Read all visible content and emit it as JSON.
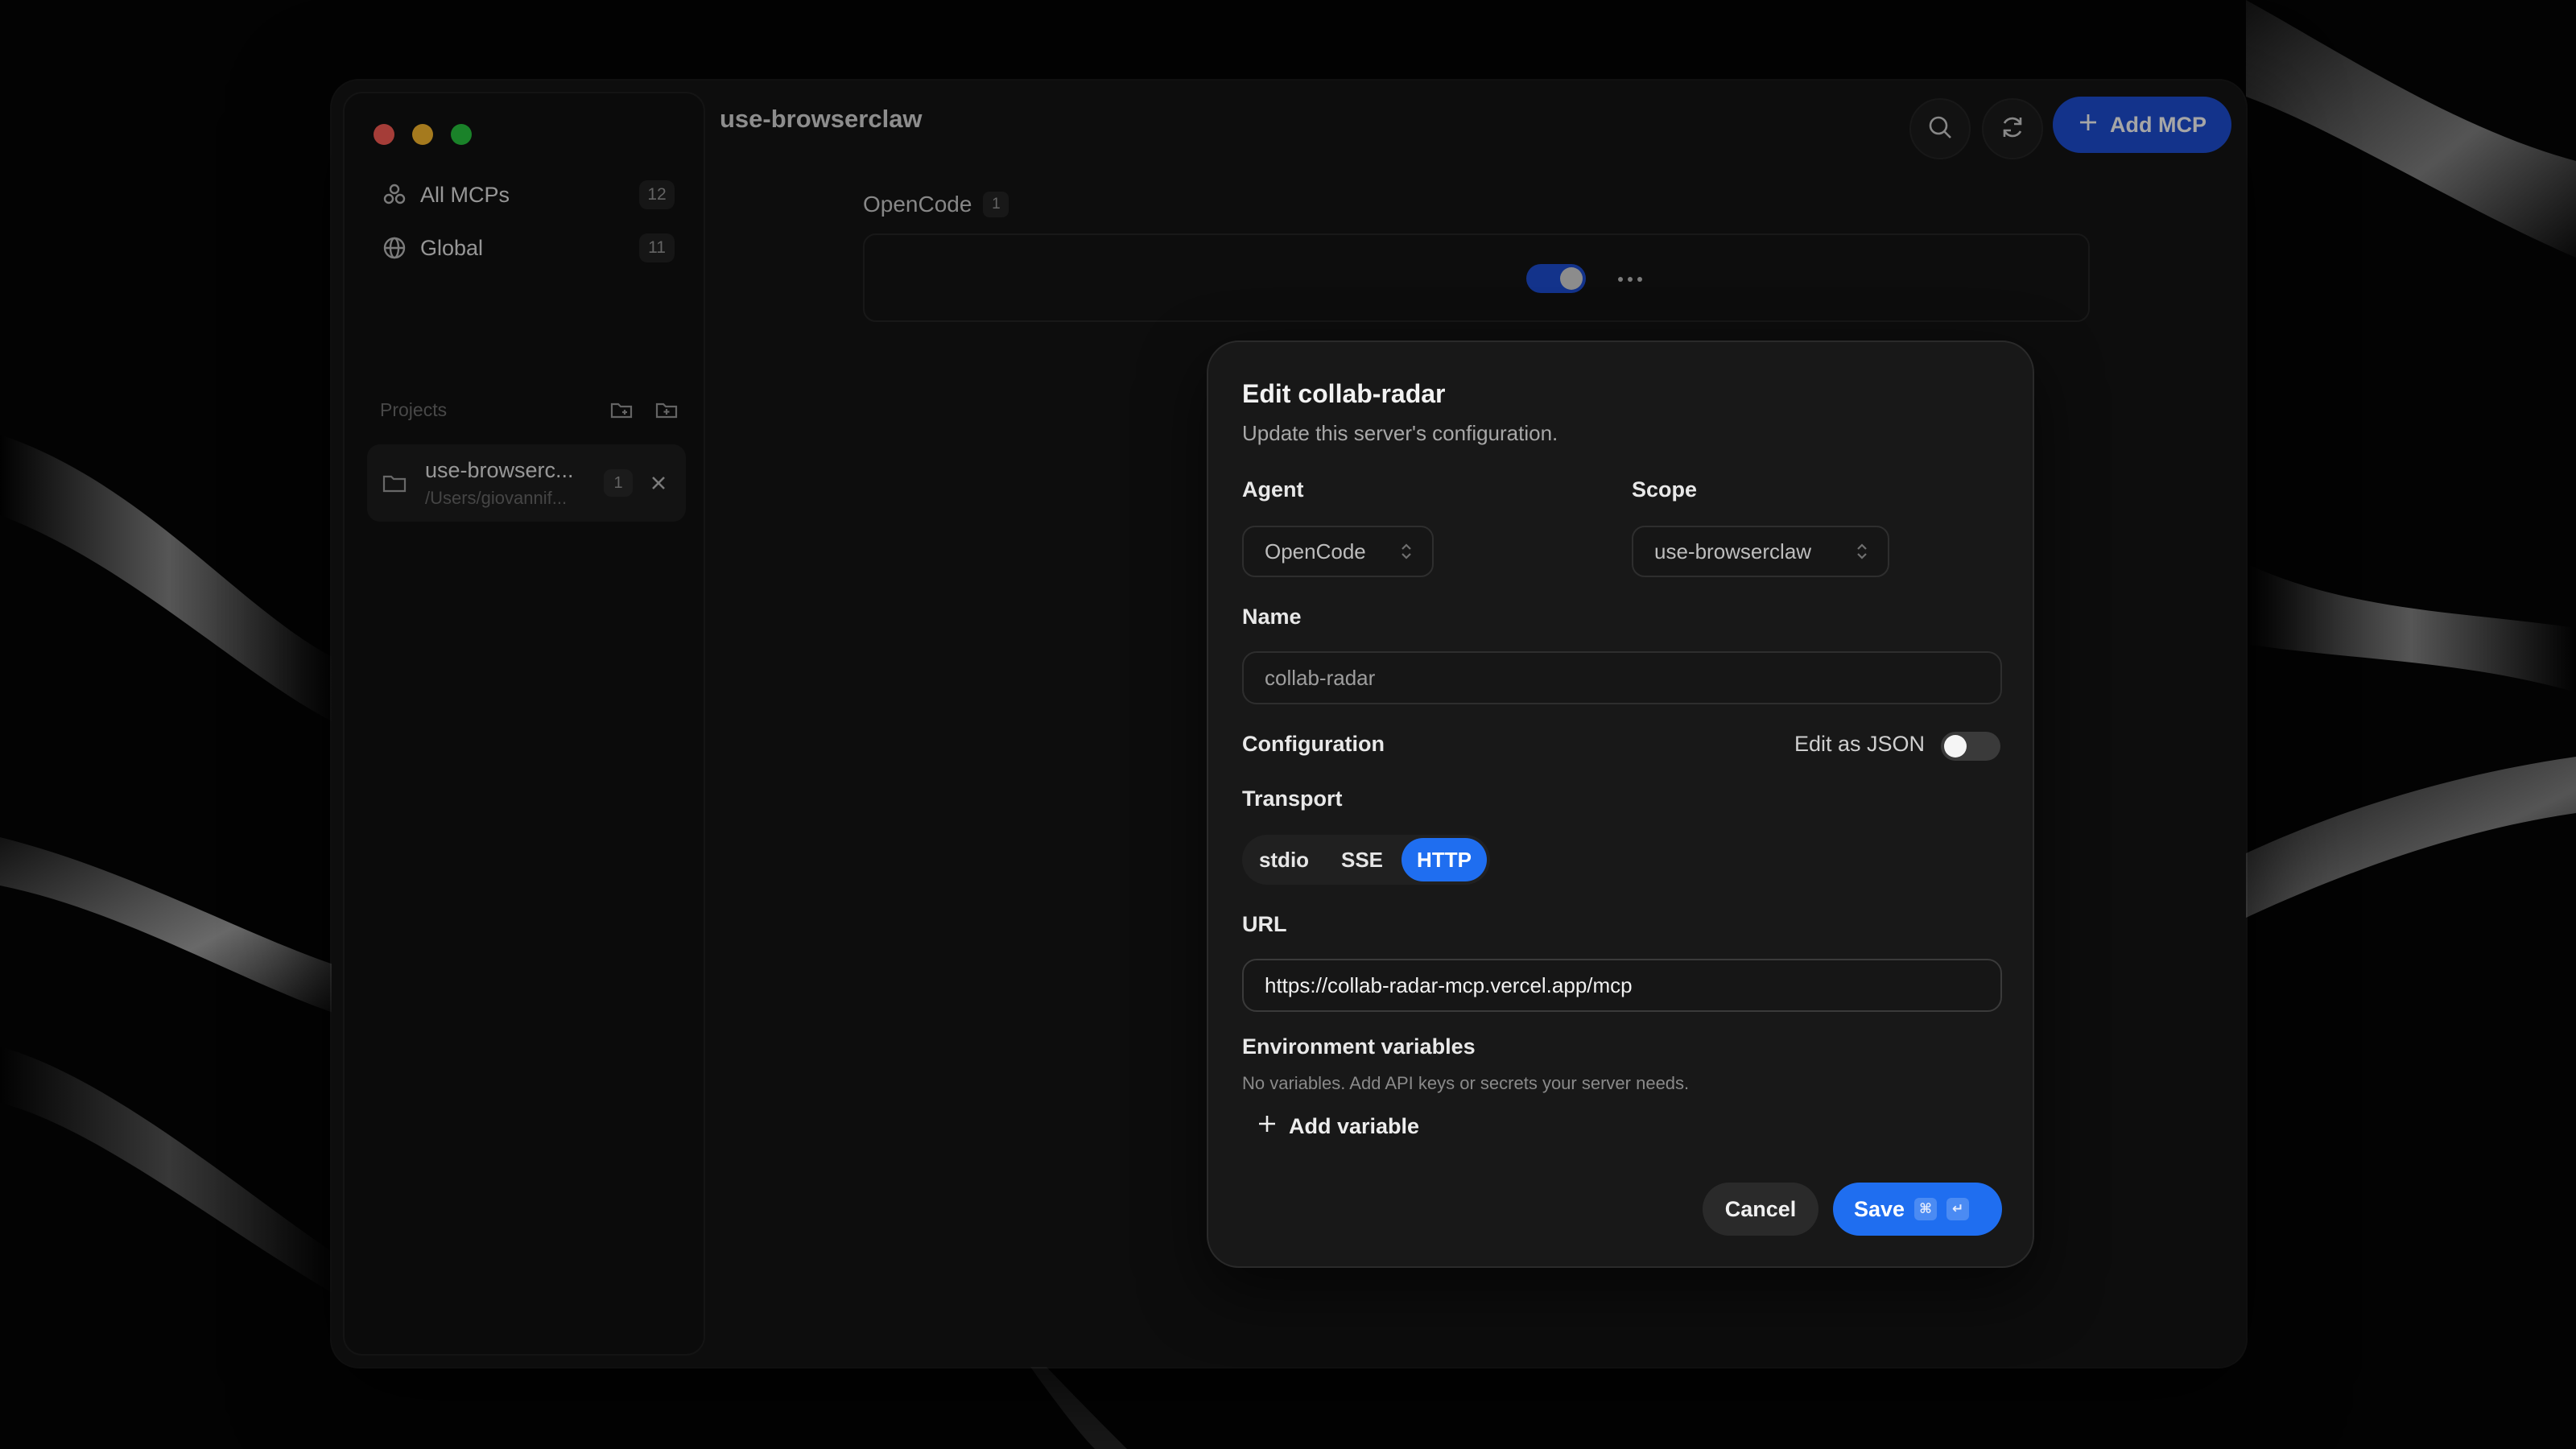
{
  "window": {
    "title": "use-browserclaw"
  },
  "sidebar": {
    "items": [
      {
        "label": "All MCPs",
        "count": "12",
        "icon": "stack-icon"
      },
      {
        "label": "Global",
        "count": "11",
        "icon": "globe-icon"
      }
    ],
    "projects_title": "Projects",
    "projects": [
      {
        "name": "use-browserc...",
        "path": "/Users/giovannif...",
        "count": "1"
      }
    ]
  },
  "header": {
    "add_label": "Add MCP"
  },
  "main": {
    "group_name": "OpenCode",
    "group_count": "1",
    "card_enabled": true
  },
  "dialog": {
    "title": "Edit collab-radar",
    "subtitle": "Update this server's configuration.",
    "agent_label": "Agent",
    "agent_value": "OpenCode",
    "scope_label": "Scope",
    "scope_value": "use-browserclaw",
    "name_label": "Name",
    "name_value": "collab-radar",
    "config_label": "Configuration",
    "json_label": "Edit as JSON",
    "json_enabled": false,
    "transport_label": "Transport",
    "transport_options": [
      "stdio",
      "SSE",
      "HTTP"
    ],
    "transport_selected": "HTTP",
    "url_label": "URL",
    "url_value": "https://collab-radar-mcp.vercel.app/mcp",
    "env_label": "Environment variables",
    "env_note": "No variables. Add API keys or secrets your server needs.",
    "add_variable_label": "Add variable",
    "cancel_label": "Cancel",
    "save_label": "Save",
    "save_shortcut": [
      "⌘",
      "↵"
    ]
  },
  "colors": {
    "accent": "#1f6ef0",
    "header_button": "#1e4fd6",
    "background": "#141414"
  }
}
